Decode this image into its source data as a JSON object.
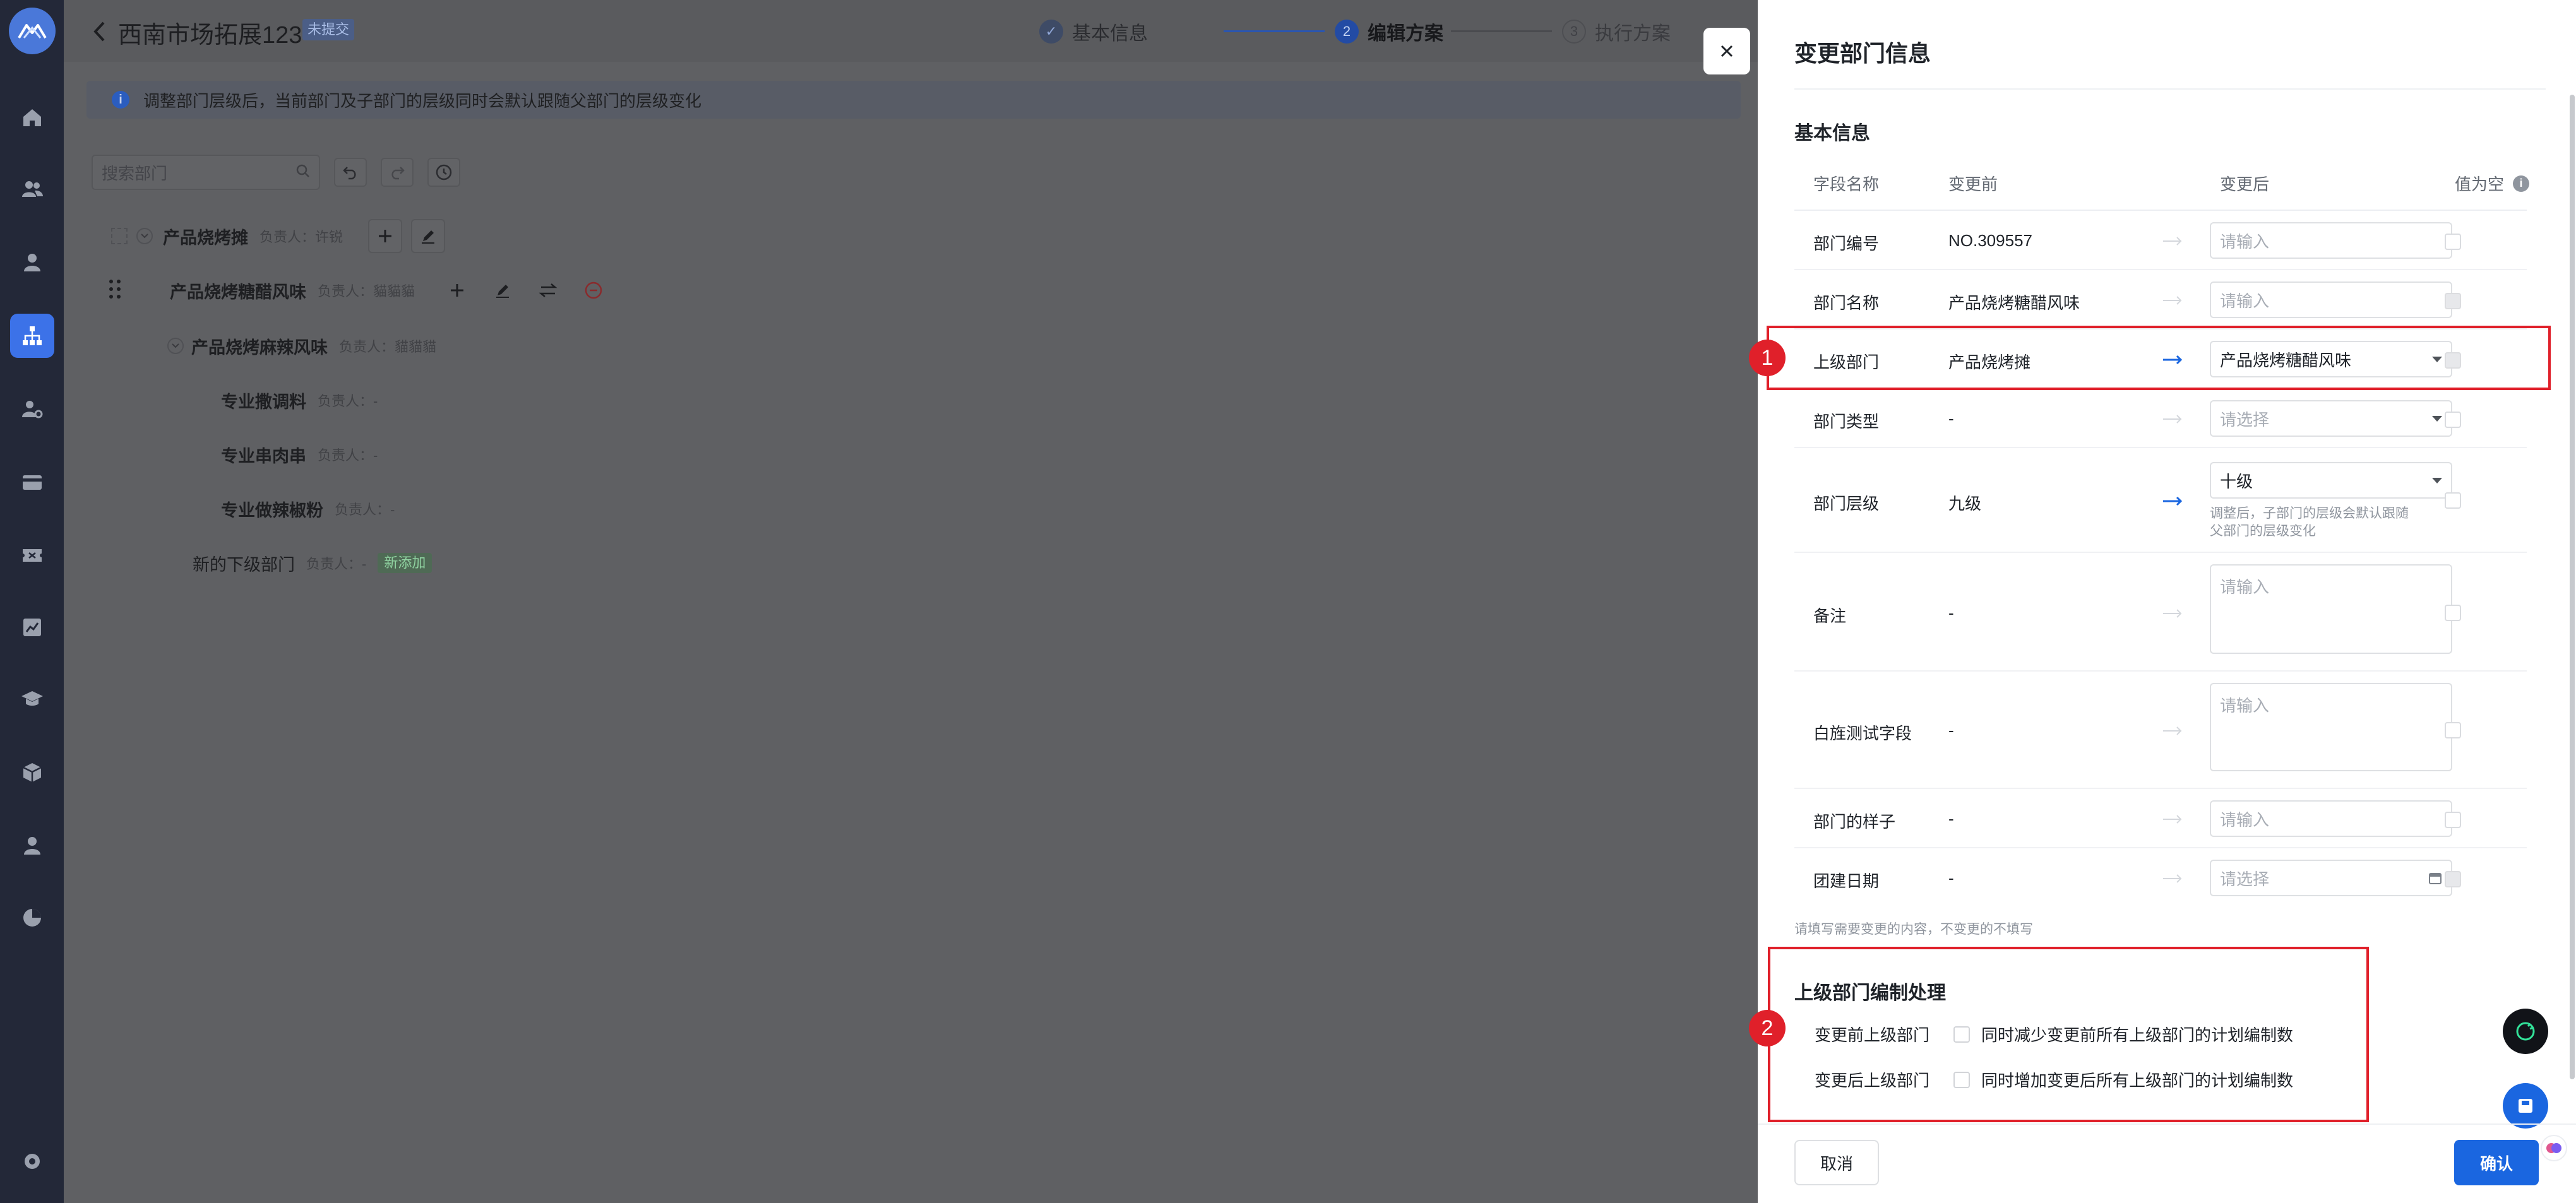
{
  "rail": {
    "items": [
      "logo-icon",
      "home-icon",
      "users-icon",
      "person-icon",
      "org-chart-icon",
      "person-settings-icon",
      "card-icon",
      "ticket-icon",
      "chart-icon",
      "graduation-icon",
      "cube-icon",
      "person-badge-icon",
      "pie-icon",
      "settings-icon"
    ],
    "active": "org-chart-icon"
  },
  "header": {
    "title": "西南市场拓展123",
    "badge": "未提交",
    "steps": [
      {
        "num": "✓",
        "label": "基本信息",
        "state": "done"
      },
      {
        "num": "2",
        "label": "编辑方案",
        "state": "active"
      },
      {
        "num": "3",
        "label": "执行方案",
        "state": "todo"
      }
    ]
  },
  "notice": {
    "icon": "i",
    "text": "调整部门层级后，当前部门及子部门的层级同时会默认跟随父部门的层级变化"
  },
  "search": {
    "placeholder": "搜索部门"
  },
  "tree": {
    "rows": [
      {
        "name": "产品烧烤摊",
        "owner": "负责人：许锐"
      },
      {
        "name": "产品烧烤糖醋风味",
        "owner": "负责人：貓貓貓"
      },
      {
        "name": "产品烧烤麻辣风味",
        "owner": "负责人：貓貓貓"
      },
      {
        "name": "专业撒调料",
        "owner": "负责人：-"
      },
      {
        "name": "专业串肉串",
        "owner": "负责人：-"
      },
      {
        "name": "专业做辣椒粉",
        "owner": "负责人：-"
      },
      {
        "name": "新的下级部门",
        "owner": "负责人：-",
        "tag": "新添加"
      }
    ]
  },
  "drawer": {
    "title": "变更部门信息",
    "section_basic": "基本信息",
    "columns": {
      "field": "字段名称",
      "before": "变更前",
      "after": "变更后",
      "empty": "值为空"
    },
    "rows": [
      {
        "field": "部门编号",
        "before": "NO.309557",
        "after_placeholder": "请输入"
      },
      {
        "field": "部门名称",
        "before": "产品烧烤糖醋风味",
        "after_placeholder": "请输入"
      },
      {
        "field": "上级部门",
        "before": "产品烧烤摊",
        "after_value": "产品烧烤糖醋风味"
      },
      {
        "field": "部门类型",
        "before": "-",
        "after_placeholder": "请选择"
      },
      {
        "field": "部门层级",
        "before": "九级",
        "after_value": "十级",
        "hint": "调整后，子部门的层级会默认跟随父部门的层级变化"
      },
      {
        "field": "备注",
        "before": "-",
        "after_placeholder": "请输入"
      },
      {
        "field": "白旌测试字段",
        "before": "-",
        "after_placeholder": "请输入"
      },
      {
        "field": "部门的样子",
        "before": "-",
        "after_placeholder": "请输入"
      },
      {
        "field": "团建日期",
        "before": "-",
        "after_placeholder": "请选择"
      }
    ],
    "foot_note": "请填写需要变更的内容，不变更的不填写",
    "section_parent": "上级部门编制处理",
    "options": [
      {
        "label": "变更前上级部门",
        "text": "同时减少变更前所有上级部门的计划编制数"
      },
      {
        "label": "变更后上级部门",
        "text": "同时增加变更后所有上级部门的计划编制数"
      }
    ],
    "cancel": "取消",
    "confirm": "确认"
  },
  "annotations": [
    "1",
    "2"
  ],
  "colors": {
    "primary": "#1a66e0",
    "annotation": "#e0202a",
    "rail": "#232838"
  }
}
